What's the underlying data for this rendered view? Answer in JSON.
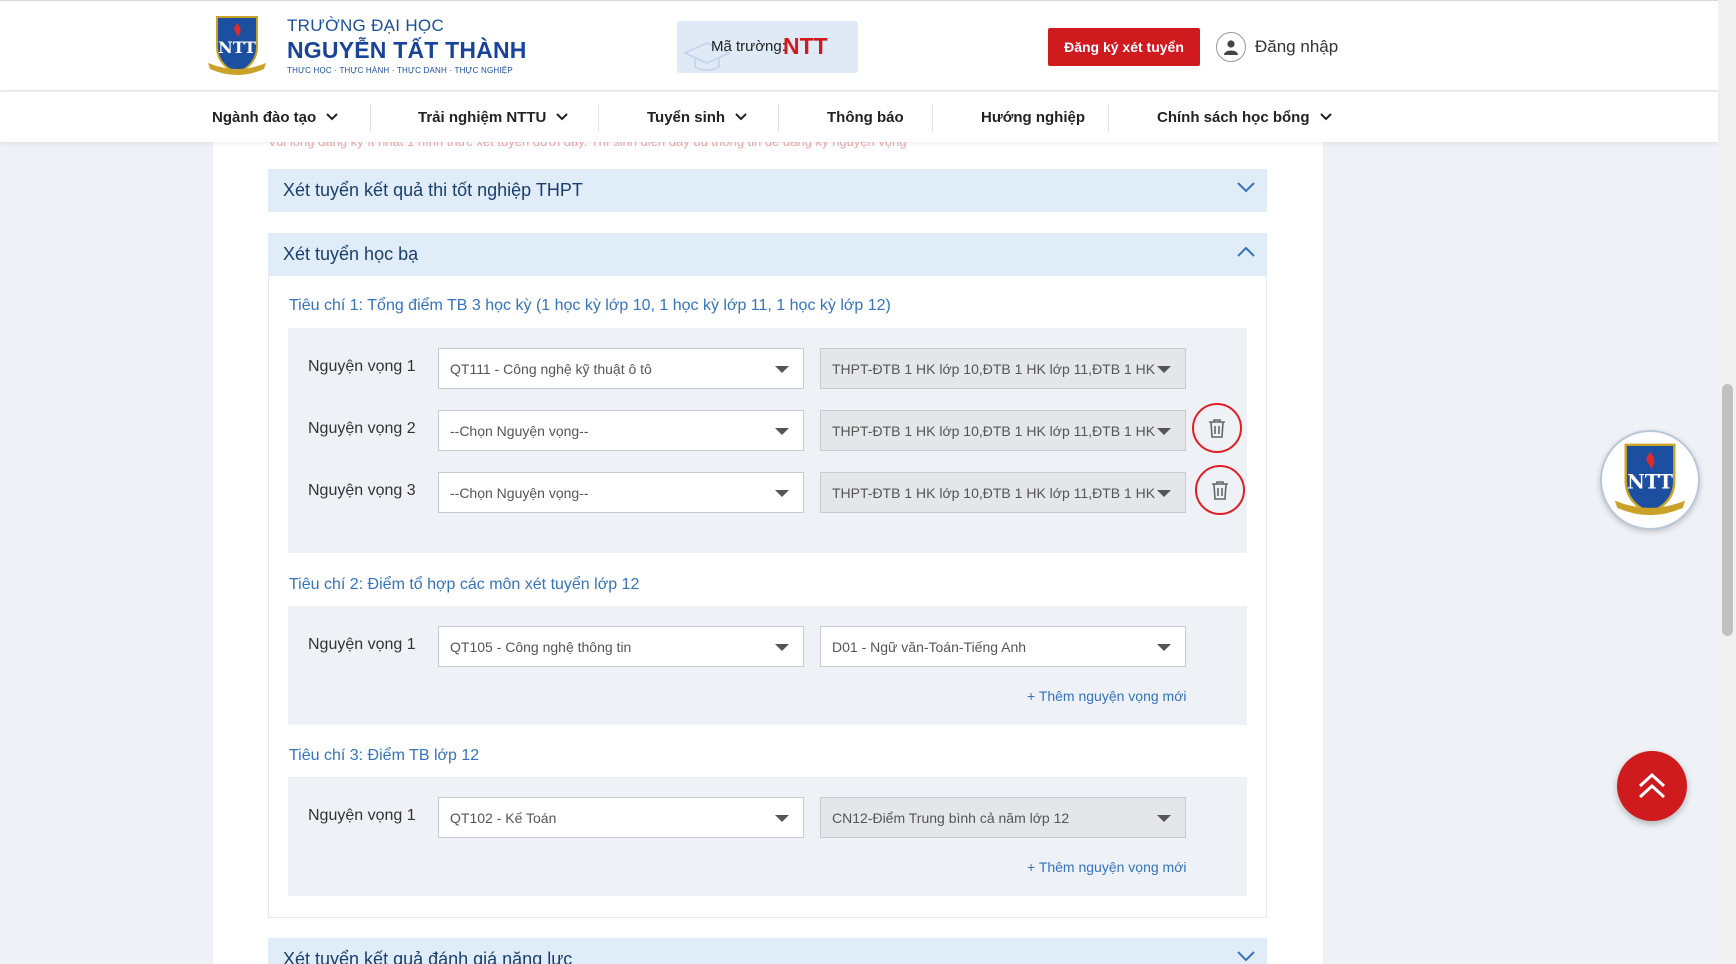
{
  "header": {
    "logo_line1": "TRƯỜNG ĐẠI HỌC",
    "logo_line2": "NGUYỄN TẤT THÀNH",
    "logo_line3": "THỰC HỌC · THỰC HÀNH · THỰC DANH · THỰC NGHIỆP",
    "school_code_label": "Mã trường:",
    "school_code_value": "NTT",
    "register_button": "Đăng ký xét tuyển",
    "login_label": "Đăng nhập"
  },
  "nav": {
    "items": [
      {
        "label": "Ngành đào tạo",
        "has_dropdown": true
      },
      {
        "label": "Trải nghiệm NTTU",
        "has_dropdown": true
      },
      {
        "label": "Tuyển sinh",
        "has_dropdown": true
      },
      {
        "label": "Thông báo",
        "has_dropdown": false
      },
      {
        "label": "Hướng nghiệp",
        "has_dropdown": false
      },
      {
        "label": "Chính sách học bổng",
        "has_dropdown": true
      }
    ]
  },
  "notice": "Vui lòng đăng ký ít nhất 1 hình thức xét tuyển dưới đây. Thí sinh điền đầy đủ thông tin để đăng ký nguyện vọng",
  "sections": [
    {
      "title": "Xét tuyển kết quả thi tốt nghiệp THPT",
      "expanded": false
    },
    {
      "title": "Xét tuyển học bạ",
      "expanded": true
    },
    {
      "title": "Xét tuyển kết quả đánh giá năng lực",
      "expanded": false
    }
  ],
  "criteria": [
    {
      "title": "Tiêu chí 1: Tổng điểm TB 3 học kỳ (1 học kỳ lớp 10, 1 học kỳ lớp 11, 1 học kỳ lớp 12)",
      "rows": [
        {
          "label": "Nguyện vọng 1",
          "major": "QT111 - Công nghệ kỹ thuật ô tô",
          "combo": "THPT-ĐTB 1 HK lớp 10,ĐTB 1 HK lớp 11,ĐTB 1 HK",
          "deletable": false
        },
        {
          "label": "Nguyện vọng 2",
          "major": "--Chọn Nguyện vọng--",
          "combo": "THPT-ĐTB 1 HK lớp 10,ĐTB 1 HK lớp 11,ĐTB 1 HK",
          "deletable": true
        },
        {
          "label": "Nguyện vọng 3",
          "major": "--Chọn Nguyện vọng--",
          "combo": "THPT-ĐTB 1 HK lớp 10,ĐTB 1 HK lớp 11,ĐTB 1 HK",
          "deletable": true
        }
      ]
    },
    {
      "title": "Tiêu chí 2: Điểm tổ hợp các môn xét tuyển lớp 12",
      "rows": [
        {
          "label": "Nguyện vọng 1",
          "major": "QT105 - Công nghệ thông tin",
          "combo": "D01 - Ngữ văn-Toán-Tiếng Anh",
          "deletable": false
        }
      ],
      "add_link": "+ Thêm nguyện vọng mới"
    },
    {
      "title": "Tiêu chí 3: Điểm TB lớp 12",
      "rows": [
        {
          "label": "Nguyện vọng 1",
          "major": "QT102 - Kế Toán",
          "combo": "CN12-Điểm Trung bình cả năm lớp 12",
          "deletable": false
        }
      ],
      "add_link": "+ Thêm nguyện vọng mới"
    }
  ],
  "colors": {
    "brand_red": "#cf1a1e",
    "brand_blue": "#17449a",
    "link_blue": "#3573bd",
    "accordion_bg": "#e0ecf8"
  }
}
